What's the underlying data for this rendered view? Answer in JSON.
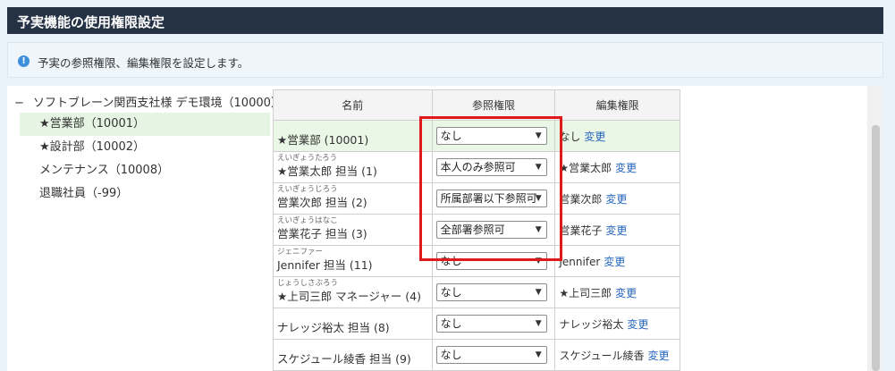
{
  "header": {
    "title": "予実機能の使用権限設定"
  },
  "info": {
    "text": "予実の参照権限、編集権限を設定します。"
  },
  "tree": {
    "root_toggle": "−",
    "root_label": "ソフトブレーン関西支社様 デモ環境（10000）",
    "nodes": [
      {
        "label": "★営業部（10001）",
        "selected": true
      },
      {
        "label": "★設計部（10002）",
        "selected": false
      },
      {
        "label": "メンテナンス（10008）",
        "selected": false
      },
      {
        "label": "退職社員（-99）",
        "selected": false
      }
    ]
  },
  "table": {
    "headers": {
      "name": "名前",
      "view": "参照権限",
      "edit": "編集権限"
    },
    "change_label": "変更",
    "rows": [
      {
        "furigana": "",
        "name": "★営業部 (10001)",
        "view": "なし",
        "edit": "なし"
      },
      {
        "furigana": "えいぎょうたろう",
        "name": "★営業太郎 担当 (1)",
        "view": "本人のみ参照可",
        "edit": "★営業太郎"
      },
      {
        "furigana": "えいぎょうじろう",
        "name": "営業次郎 担当 (2)",
        "view": "所属部署以下参照可",
        "edit": "営業次郎"
      },
      {
        "furigana": "えいぎょうはなこ",
        "name": "営業花子 担当 (3)",
        "view": "全部署参照可",
        "edit": "営業花子"
      },
      {
        "furigana": "ジェニファー",
        "name": "Jennifer 担当 (11)",
        "view": "なし",
        "edit": "Jennifer"
      },
      {
        "furigana": "じょうしさぶろう",
        "name": "★上司三郎 マネージャー (4)",
        "view": "なし",
        "edit": "★上司三郎"
      },
      {
        "furigana": "",
        "name": "ナレッジ裕太 担当 (8)",
        "view": "なし",
        "edit": "ナレッジ裕太"
      },
      {
        "furigana": "",
        "name": "スケジュール綾香 担当 (9)",
        "view": "なし",
        "edit": "スケジュール綾香"
      }
    ]
  },
  "colors": {
    "header_bg": "#253145",
    "highlight_box": "#e01a1a",
    "link": "#2566bf",
    "selected_bg": "#e6f5e3"
  },
  "icons": {
    "info": "info-icon",
    "dropdown": "dropdown-arrow-icon"
  }
}
